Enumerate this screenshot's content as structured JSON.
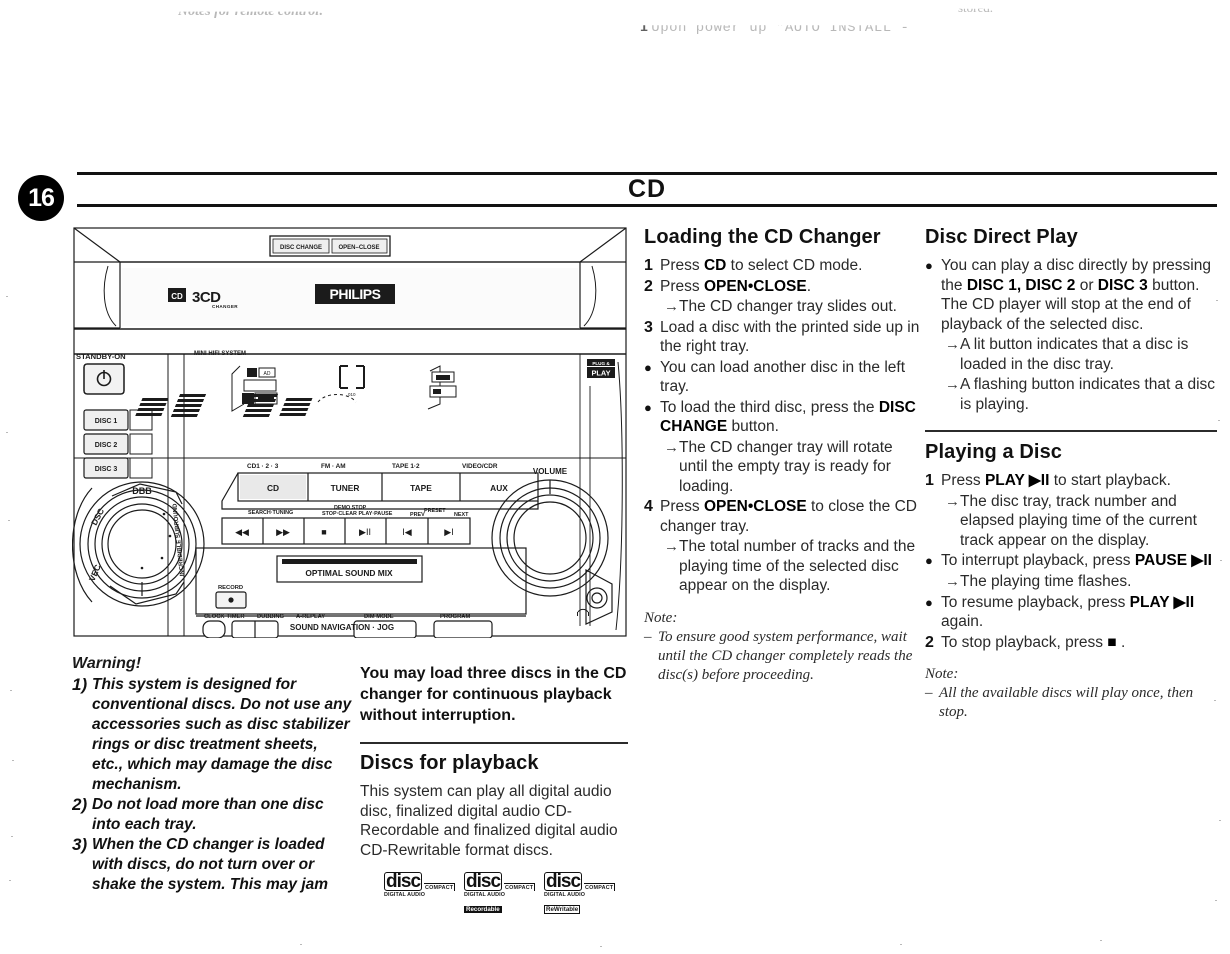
{
  "bleed": {
    "left": "Notes for remote control:",
    "center_num": "1",
    "center": "Upon power up \"AUTO INSTALL -",
    "right": "stored."
  },
  "header": {
    "page_number": "16",
    "title": "CD"
  },
  "diagram": {
    "name": "philips-mini-hifi-system-front-panel",
    "top_buttons": [
      "DISC CHANGE",
      "OPEN•CLOSE"
    ],
    "brand": "PHILIPS",
    "badge_3cd": "3CD",
    "badge_3cd_sub": "CHANGER",
    "model_text": "MINI HIFI SYSTEM",
    "standby_label": "STANDBY-ON",
    "disc_buttons": [
      "DISC 1",
      "DISC 2",
      "DISC 3"
    ],
    "plug_play": [
      "PLUG &",
      "PLAY"
    ],
    "source_top_labels": [
      "CD1 · 2 · 3",
      "FM · AM",
      "TAPE 1·2",
      "VIDEO/CDR"
    ],
    "source_buttons": [
      "CD",
      "TUNER",
      "TAPE",
      "AUX"
    ],
    "volume_label": "VOLUME",
    "transport_labels": {
      "search": "SEARCH·TUNING",
      "demo_stop": "DEMO STOP",
      "stop_clear": "STOP·CLEAR  PLAY·PAUSE",
      "prev": "PREV",
      "preset": "PRESET",
      "next": "NEXT"
    },
    "transport_glyphs": [
      "◀◀",
      "▶▶",
      "■",
      "▶II",
      "I◀◀",
      "▶▶I"
    ],
    "display_text": "OPTIMAL SOUND MIX",
    "record_label": "RECORD",
    "bottom_buttons": [
      "CLOCK·TIMER",
      "DUBBING",
      "A-REPLAY",
      "DIM MODE",
      "PROGRAM"
    ],
    "jog_label": "SOUND NAVIGATION · JOG",
    "knob_labels": [
      "DBB",
      "DSC",
      "VEC",
      "INCREDIBLE SURROUND"
    ],
    "headphone_icon": "headphone-icon"
  },
  "loading_section": {
    "heading": "Loading the CD Changer",
    "steps": [
      {
        "mark": "1",
        "type": "num",
        "text_html": "Press <b>CD</b> to select CD mode."
      },
      {
        "mark": "2",
        "type": "num",
        "text_html": "Press <b>OPEN•CLOSE</b>."
      },
      {
        "mark": "→",
        "type": "arrow",
        "text_html": "The CD changer tray slides out."
      },
      {
        "mark": "3",
        "type": "num",
        "text_html": "Load a disc with the printed side up in the right tray."
      },
      {
        "mark": "●",
        "type": "dot",
        "text_html": "You can load another disc in the left tray."
      },
      {
        "mark": "●",
        "type": "dot",
        "text_html": "To load the third disc, press the <b>DISC CHANGE</b> button."
      },
      {
        "mark": "→",
        "type": "arrow",
        "text_html": "The CD changer tray will rotate until the empty tray is ready for loading."
      },
      {
        "mark": "4",
        "type": "num",
        "text_html": "Press <b>OPEN•CLOSE</b> to close the CD changer tray."
      },
      {
        "mark": "→",
        "type": "arrow",
        "text_html": "The total number of tracks and the playing time of the selected disc appear on the display."
      }
    ],
    "note_label": "Note:",
    "note_items": [
      "To ensure good system performance, wait until the CD changer completely reads the disc(s) before proceeding."
    ]
  },
  "direct_play_section": {
    "heading": "Disc Direct Play",
    "steps": [
      {
        "mark": "●",
        "type": "dot",
        "text_html": "You can play a disc directly by pressing the <b>DISC 1, DISC 2</b> or <b>DISC 3</b> button. The CD player will stop at the end of playback of the selected disc."
      },
      {
        "mark": "→",
        "type": "arrow",
        "text_html": "A lit button indicates that a disc is loaded in the disc tray."
      },
      {
        "mark": "→",
        "type": "arrow",
        "text_html": "A flashing button indicates that a disc is playing."
      }
    ]
  },
  "playing_section": {
    "heading": "Playing a Disc",
    "steps": [
      {
        "mark": "1",
        "type": "num",
        "text_html": "Press <b>PLAY ▶II</b> to start playback."
      },
      {
        "mark": "→",
        "type": "arrow",
        "text_html": "The disc tray, track number and elapsed playing time of the current track appear on the display."
      },
      {
        "mark": "●",
        "type": "dot",
        "text_html": "To interrupt playback, press <b>PAUSE ▶II</b>"
      },
      {
        "mark": "→",
        "type": "arrow",
        "text_html": "The playing time flashes."
      },
      {
        "mark": "●",
        "type": "dot",
        "text_html": "To resume playback, press <b>PLAY ▶II</b> again."
      },
      {
        "mark": "2",
        "type": "num",
        "text_html": "To stop playback, press <b>■</b> ."
      }
    ],
    "note_label": "Note:",
    "note_items": [
      "All the available discs will play once, then stop."
    ]
  },
  "warning_section": {
    "title": "Warning!",
    "items": [
      {
        "num": "1)",
        "text": "This system is designed for conventional discs. Do not use any accessories such as disc stabilizer rings or disc treatment sheets, etc., which may damage the disc mechanism."
      },
      {
        "num": "2)",
        "text": "Do not load more than one disc into each tray."
      },
      {
        "num": "3)",
        "text": "When the CD changer is loaded with discs, do not turn over or shake the system. This may jam"
      }
    ]
  },
  "load_three_block": {
    "lead": "You may load three discs in the CD changer for continuous playback without interruption.",
    "heading": "Discs for playback",
    "body": "This system can play all digital audio disc, finalized digital audio CD-Recordable and finalized digital audio CD-Rewritable format discs."
  },
  "cd_logos": [
    {
      "compact": "COMPACT",
      "disc": "disc",
      "digital_audio": "DIGITAL AUDIO",
      "tag": "",
      "tag_style": "none"
    },
    {
      "compact": "COMPACT",
      "disc": "disc",
      "digital_audio": "DIGITAL AUDIO",
      "tag": "Recordable",
      "tag_style": "black"
    },
    {
      "compact": "COMPACT",
      "disc": "disc",
      "digital_audio": "DIGITAL AUDIO",
      "tag": "ReWritable",
      "tag_style": "white"
    }
  ],
  "colors": {
    "ink": "#1a1a1a",
    "rule": "#111111",
    "badge_bg": "#000000",
    "badge_fg": "#ffffff",
    "body_text": "#2a2a2a"
  }
}
